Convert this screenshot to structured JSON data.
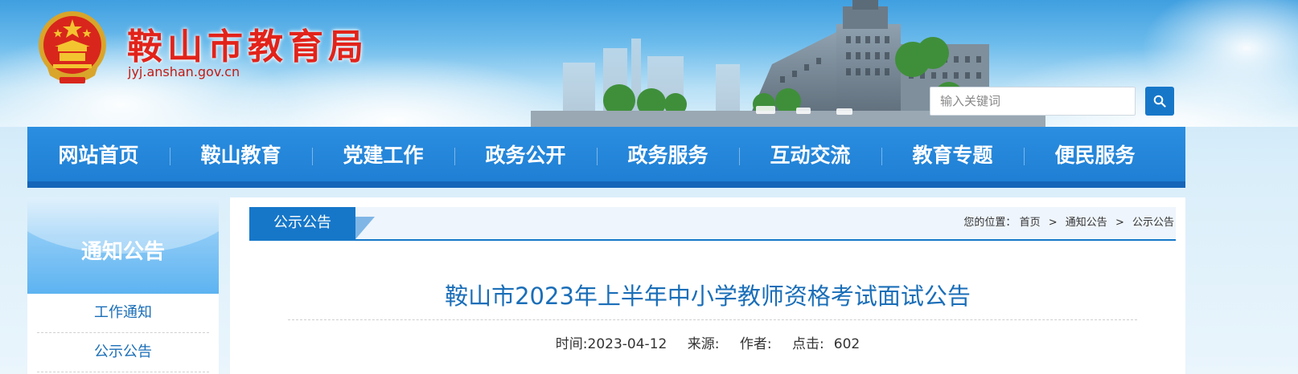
{
  "header": {
    "site_title": "鞍山市教育局",
    "site_domain": "jyj.anshan.gov.cn",
    "emblem_icon": "national-emblem-icon"
  },
  "search": {
    "placeholder": "输入关键词",
    "button_icon": "search-icon"
  },
  "nav": {
    "items": [
      "网站首页",
      "鞍山教育",
      "党建工作",
      "政务公开",
      "政务服务",
      "互动交流",
      "教育专题",
      "便民服务"
    ]
  },
  "sidebar": {
    "title": "通知公告",
    "links": [
      "工作通知",
      "公示公告"
    ]
  },
  "section": {
    "tab_label": "公示公告",
    "breadcrumb_prefix": "您的位置：",
    "breadcrumb": [
      "首页",
      "通知公告",
      "公示公告"
    ],
    "breadcrumb_separator": ">"
  },
  "article": {
    "title": "鞍山市2023年上半年中小学教师资格考试面试公告",
    "time": "时间:2023-04-12",
    "source": "来源:",
    "author": "作者:",
    "views_label": "点击:",
    "views": "602"
  },
  "colors": {
    "primary": "#1677c9",
    "title_red": "#e2231a",
    "link_blue": "#1a6eb8"
  }
}
